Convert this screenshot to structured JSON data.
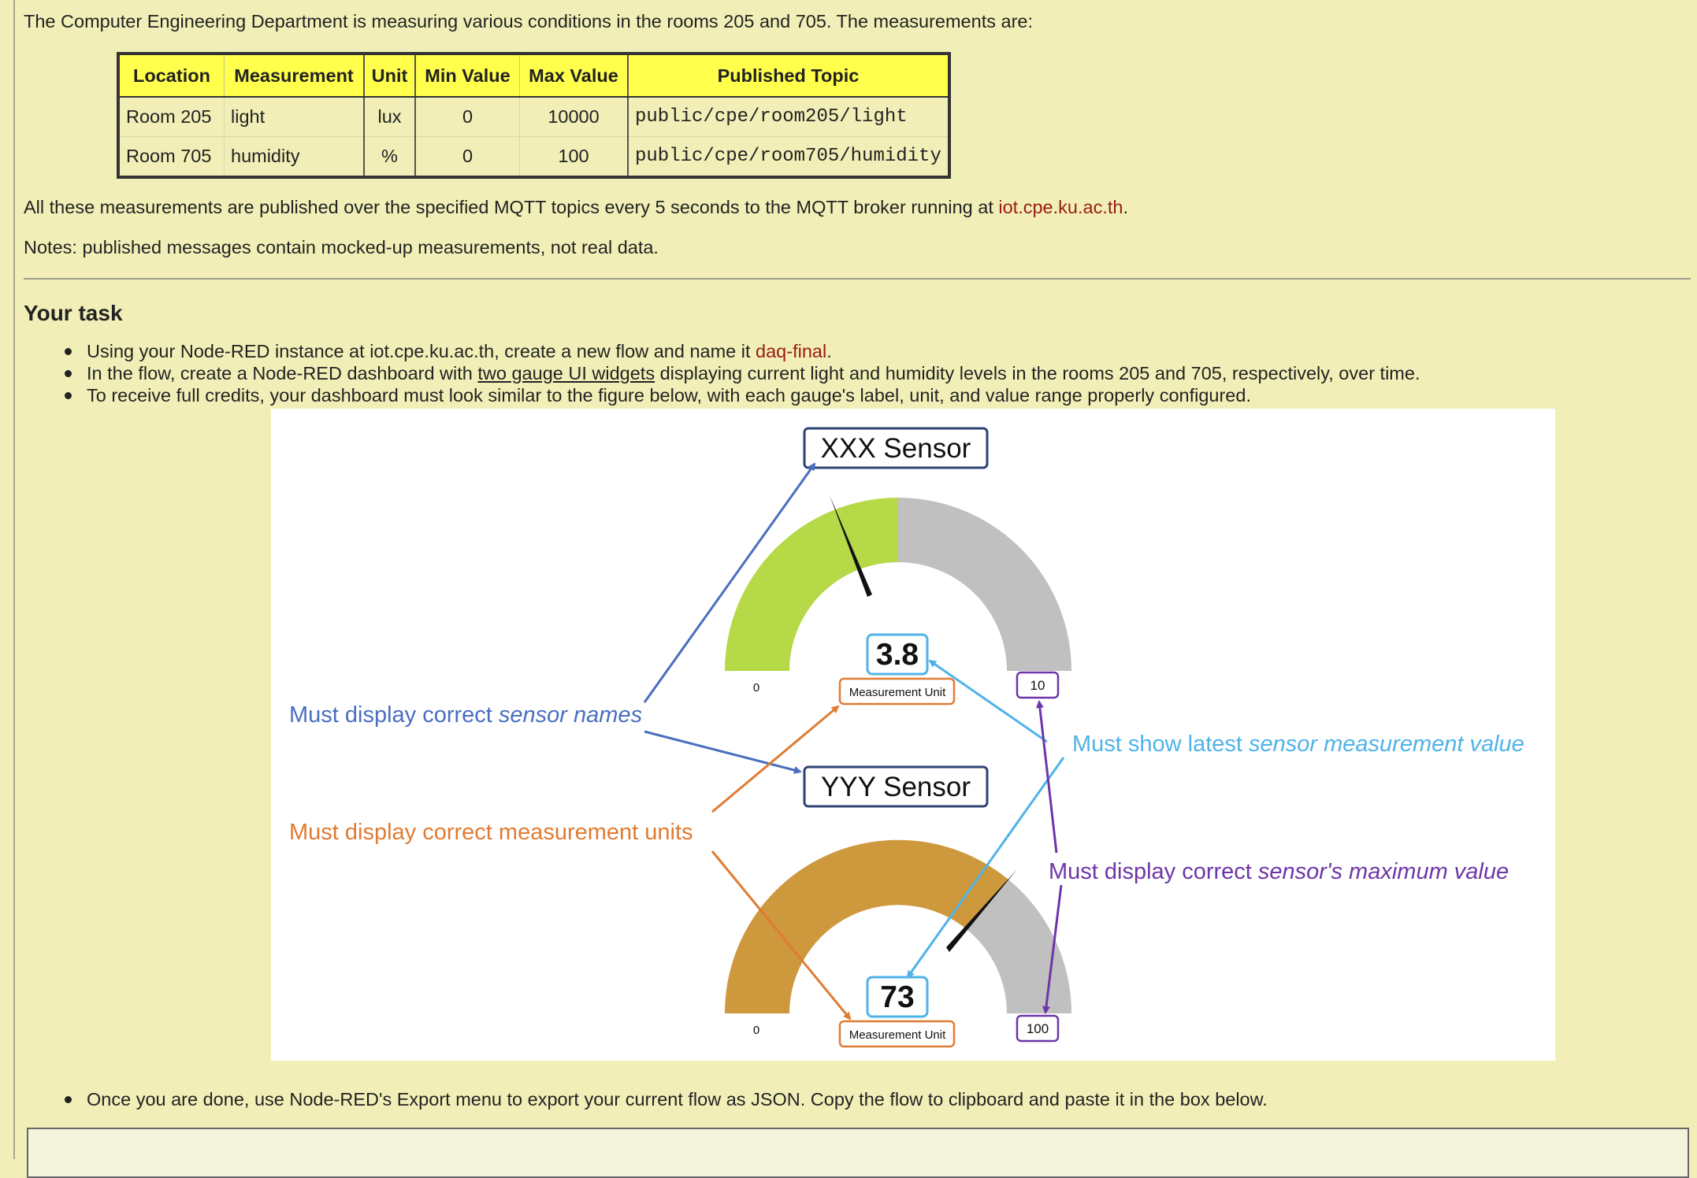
{
  "intro": "The Computer Engineering Department is measuring various conditions in the rooms 205 and 705. The measurements are:",
  "table": {
    "headers": [
      "Location",
      "Measurement",
      "Unit",
      "Min Value",
      "Max Value",
      "Published Topic"
    ],
    "rows": [
      [
        "Room 205",
        "light",
        "lux",
        "0",
        "10000",
        "public/cpe/room205/light"
      ],
      [
        "Room 705",
        "humidity",
        "%",
        "0",
        "100",
        "public/cpe/room705/humidity"
      ]
    ]
  },
  "publish_note": {
    "text": "All these measurements are published over the specified MQTT topics every 5 seconds to the MQTT broker running at ",
    "link": "iot.cpe.ku.ac.th",
    "suffix": "."
  },
  "notes": "Notes: published messages contain mocked-up measurements, not real data.",
  "task_heading": "Your task",
  "tasks": {
    "t1_text": "Using your Node-RED instance at iot.cpe.ku.ac.th, create a new flow and name it ",
    "t1_link": "daq-final",
    "t1_suffix": ".",
    "t2_pre": "In the flow, create a Node-RED dashboard with ",
    "t2_underlined": "two gauge UI widgets",
    "t2_post": " displaying current light and humidity levels in the rooms 205 and 705, respectively, over time.",
    "t3": "To receive full credits, your dashboard must look similar to the figure below, with each gauge's label, unit, and value range properly configured.",
    "t4": "Once you are done, use Node-RED's Export menu to export your current flow as JSON. Copy the flow to clipboard and paste it in the box below."
  },
  "figure": {
    "gauge1": {
      "title": "XXX Sensor",
      "value": "3.8",
      "min": "0",
      "max": "10",
      "unit": "Measurement Unit",
      "fill_color": "#b5d947"
    },
    "gauge2": {
      "title": "YYY Sensor",
      "value": "73",
      "min": "0",
      "max": "100",
      "unit": "Measurement Unit",
      "fill_color": "#ce983c"
    },
    "annotations": {
      "names": {
        "pre": "Must display correct ",
        "em": "sensor names",
        "color": "#4a6fbf"
      },
      "units": {
        "text": "Must display correct measurement units",
        "color": "#e07b32"
      },
      "latest": {
        "pre": "Must show latest ",
        "em": "sensor measurement value",
        "color": "#4fb3e8"
      },
      "maximum": {
        "pre": "Must display correct ",
        "em": "sensor's maximum value",
        "color": "#6e35a8"
      }
    }
  },
  "colors": {
    "background": "#f1efb7",
    "header_yellow": "#ffff4c",
    "link_red": "#9a1a16",
    "gauge_gray": "#c0c0c0"
  }
}
